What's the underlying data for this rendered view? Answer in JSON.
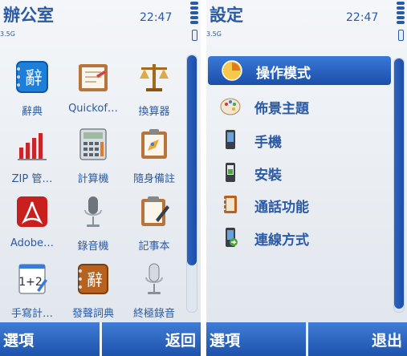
{
  "left_screen": {
    "title": "辦公室",
    "time": "22:47",
    "network": "3.5G",
    "apps": [
      {
        "label": "辭典",
        "icon": "dictionary-icon"
      },
      {
        "label": "Quickof…",
        "icon": "quickoffice-icon"
      },
      {
        "label": "換算器",
        "icon": "converter-scale-icon"
      },
      {
        "label": "ZIP 管…",
        "icon": "zip-manager-icon"
      },
      {
        "label": "計算機",
        "icon": "calculator-icon"
      },
      {
        "label": "隨身備註",
        "icon": "notes-icon"
      },
      {
        "label": "Adobe…",
        "icon": "adobe-reader-icon"
      },
      {
        "label": "錄音機",
        "icon": "recorder-microphone-icon"
      },
      {
        "label": "記事本",
        "icon": "notepad-icon"
      },
      {
        "label": "手寫計…",
        "icon": "handwriting-calculator-icon"
      },
      {
        "label": "發聲詞典",
        "icon": "talking-dictionary-icon"
      },
      {
        "label": "終極錄音",
        "icon": "ultimate-recorder-icon"
      }
    ],
    "softkeys": {
      "left": "選項",
      "right": "返回"
    },
    "scroll_position": 0.0
  },
  "right_screen": {
    "title": "設定",
    "time": "22:47",
    "network": "3.5G",
    "items": [
      {
        "label": "操作模式",
        "icon": "profiles-icon",
        "selected": true
      },
      {
        "label": "佈景主題",
        "icon": "themes-palette-icon",
        "selected": false
      },
      {
        "label": "手機",
        "icon": "phone-icon",
        "selected": false
      },
      {
        "label": "安裝",
        "icon": "installations-icon",
        "selected": false
      },
      {
        "label": "通話功能",
        "icon": "call-settings-icon",
        "selected": false
      },
      {
        "label": "連線方式",
        "icon": "connectivity-icon",
        "selected": false
      }
    ],
    "softkeys": {
      "left": "選項",
      "right": "退出"
    }
  },
  "colors": {
    "accent": "#2a5aa6",
    "selection": "#1b4fa9",
    "softbar": "#1e53ac",
    "background": "#eef1f5"
  }
}
